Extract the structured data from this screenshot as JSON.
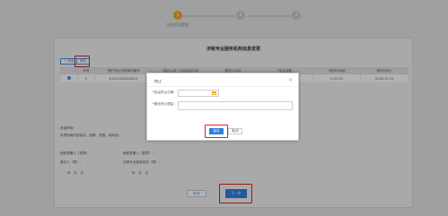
{
  "steps": [
    {
      "index": "1",
      "label": "协议信息管理",
      "active": true
    },
    {
      "index": "2",
      "label": "",
      "active": false
    },
    {
      "index": "3",
      "label": "",
      "active": false
    }
  ],
  "card": {
    "title": "涉税专业服务机构信息变更",
    "toolbar": {
      "add_label": "+ 新增",
      "delete_label": "删除"
    },
    "table": {
      "headers": [
        "",
        "序号",
        "*委托协议涉税事项编号",
        "*委托人统一社会信用代码",
        "*委托人名称",
        "*协议金额",
        "*服务时间起",
        "*服务时间止"
      ],
      "rows": [
        {
          "seq": "1",
          "c1": "K1101013010613",
          "c2": "",
          "c3": "",
          "c4": "",
          "c5": "2-01-01",
          "c6": "2018-12-31"
        }
      ]
    },
    "statement": {
      "heading": "承诺声明：",
      "text": "本表所填内容真实、准确、完整，我承诺...",
      "l1_left": "授权签署人（签章）：",
      "l1_right": "授权签署人（签章）：",
      "l2_left": "委托人（章）：",
      "l2_right": "涉税专业服务机构（章）：",
      "date_left": "年　月　日",
      "date_right": "年　月　日"
    },
    "buttons": {
      "prev": "取消",
      "next": "下一步"
    }
  },
  "modal": {
    "title": "终止",
    "close": "×",
    "field1_label": "*协议终止日期：",
    "field2_label": "*服务终止理由：",
    "confirm": "保存",
    "cancel": "取消"
  },
  "colors": {
    "accent": "#2f7fe0",
    "step_active": "#f5a623",
    "highlight": "#e02020"
  }
}
